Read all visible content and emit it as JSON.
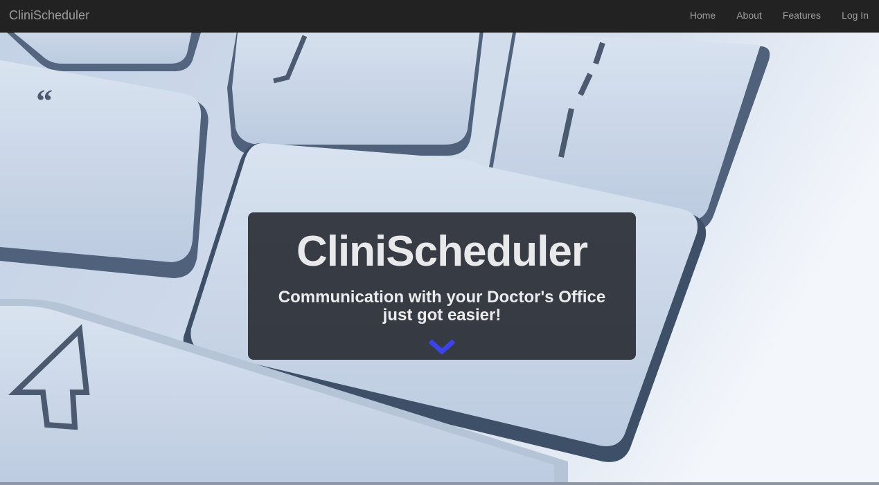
{
  "navbar": {
    "brand": "CliniScheduler",
    "links": [
      "Home",
      "About",
      "Features",
      "Log In"
    ]
  },
  "hero": {
    "title": "CliniScheduler",
    "subtitle": "Communication with your Doctor's Office just got easier!",
    "scroll_icon": "chevron-down-icon"
  },
  "colors": {
    "navbar_bg": "#222222",
    "nav_text": "#9d9d9d",
    "caption_bg": "#22252c",
    "chevron": "#3b44e8"
  }
}
